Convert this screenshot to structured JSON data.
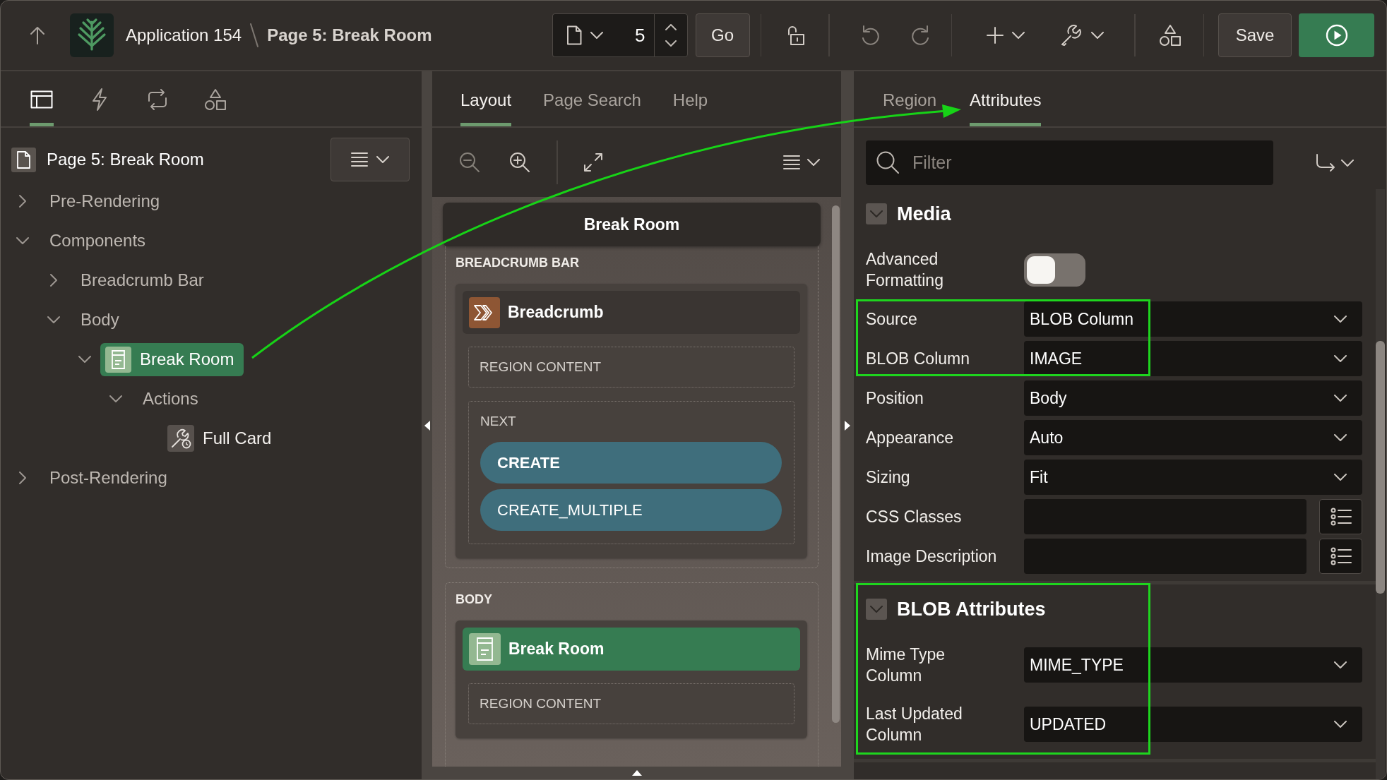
{
  "top_bar": {
    "app_name": "Application 154",
    "page_title": "Page 5: Break Room",
    "page_number": "5",
    "go_button": "Go",
    "history": [
      {
        "kind": "undo",
        "disabled": true
      },
      {
        "kind": "redo",
        "disabled": true
      }
    ],
    "save_button": "Save"
  },
  "left_panel": {
    "tabs": [
      {
        "kind": "rendering",
        "selected": true
      },
      {
        "kind": "actions",
        "selected": false
      },
      {
        "kind": "processing",
        "selected": false
      },
      {
        "kind": "shared",
        "selected": false
      }
    ],
    "page_node": "Page 5: Break Room",
    "tree": [
      {
        "label": "Pre-Rendering",
        "kind": "group",
        "expanded": false,
        "selected": false
      },
      {
        "label": "Components",
        "kind": "group",
        "expanded": true,
        "selected": false,
        "children": [
          {
            "label": "Breadcrumb Bar",
            "kind": "group",
            "expanded": false,
            "selected": false
          },
          {
            "label": "Body",
            "kind": "group",
            "expanded": true,
            "selected": false,
            "children": [
              {
                "label": "Break Room",
                "kind": "region",
                "expanded": true,
                "selected": true,
                "children": [
                  {
                    "label": "Actions",
                    "kind": "group",
                    "expanded": true,
                    "selected": false,
                    "children": [
                      {
                        "label": "Full Card",
                        "kind": "action",
                        "selected": false
                      }
                    ]
                  }
                ]
              }
            ]
          }
        ]
      },
      {
        "label": "Post-Rendering",
        "kind": "group",
        "expanded": false,
        "selected": false
      }
    ]
  },
  "layout_panel": {
    "tabs": [
      {
        "label": "Layout",
        "selected": true
      },
      {
        "label": "Page Search",
        "selected": false
      },
      {
        "label": "Help",
        "selected": false
      }
    ],
    "tools": [
      {
        "kind": "zoomout",
        "disabled": true
      },
      {
        "kind": "zoomin",
        "disabled": false
      },
      {
        "kind": "expand",
        "disabled": false
      }
    ],
    "canvas": {
      "page_title": "Break Room",
      "positions": [
        {
          "label": "BREADCRUMB BAR",
          "regions": [
            {
              "kind": "breadcrumb",
              "title": "Breadcrumb",
              "selected": false,
              "content_label": "REGION CONTENT",
              "slots": [
                {
                  "label": "NEXT",
                  "buttons": [
                    {
                      "label": "CREATE",
                      "hot": true
                    },
                    {
                      "label": "CREATE_MULTIPLE",
                      "hot": false
                    }
                  ]
                }
              ]
            }
          ]
        },
        {
          "label": "BODY",
          "regions": [
            {
              "kind": "cards",
              "title": "Break Room",
              "selected": true,
              "content_label": "REGION CONTENT"
            }
          ]
        }
      ]
    }
  },
  "property_panel": {
    "tabs": [
      {
        "label": "Region",
        "selected": false
      },
      {
        "label": "Attributes",
        "selected": true
      }
    ],
    "filter": {
      "placeholder": "Filter"
    },
    "groups": [
      {
        "title": "Media",
        "expanded": true,
        "highlighted": false,
        "properties": [
          {
            "label": "Advanced Formatting",
            "kind": "switch",
            "on": false,
            "highlighted": false
          },
          {
            "label": "Source",
            "kind": "select",
            "value": "BLOB Column",
            "highlighted": true
          },
          {
            "label": "BLOB Column",
            "kind": "select",
            "value": "IMAGE",
            "highlighted": true
          },
          {
            "label": "Position",
            "kind": "select",
            "value": "Body",
            "highlighted": false
          },
          {
            "label": "Appearance",
            "kind": "select",
            "value": "Auto",
            "highlighted": false
          },
          {
            "label": "Sizing",
            "kind": "select",
            "value": "Fit",
            "highlighted": false
          },
          {
            "label": "CSS Classes",
            "kind": "text",
            "highlighted": false
          },
          {
            "label": "Image Description",
            "kind": "text",
            "highlighted": false
          }
        ]
      },
      {
        "title": "BLOB Attributes",
        "expanded": true,
        "highlighted": true,
        "properties": [
          {
            "label": "Mime Type Column",
            "kind": "select",
            "value": "MIME_TYPE",
            "highlighted": false
          },
          {
            "label": "Last Updated Column",
            "kind": "select",
            "value": "UPDATED",
            "highlighted": false
          }
        ]
      }
    ]
  }
}
